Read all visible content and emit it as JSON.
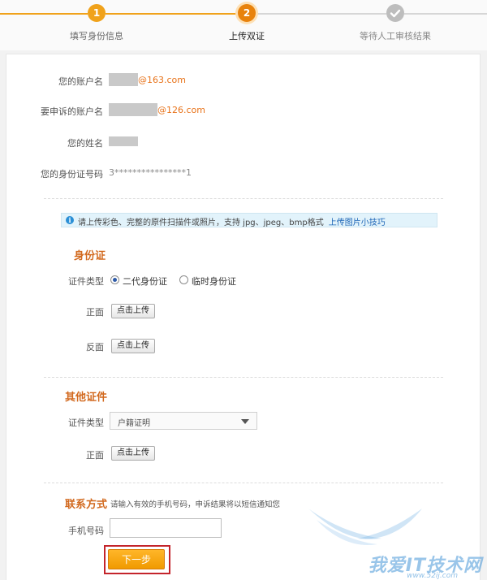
{
  "stepper": {
    "steps": [
      {
        "number": "1",
        "label": "填写身份信息"
      },
      {
        "number": "2",
        "label": "上传双证"
      },
      {
        "number": "",
        "label": "等待人工审核结果"
      }
    ],
    "colors": {
      "done": "#f0a21b",
      "active": "#e8820c",
      "pending": "#bdbdbd"
    }
  },
  "account": {
    "label": "您的账户名",
    "suffix": "@163.com"
  },
  "appeal_account": {
    "label": "要申诉的账户名",
    "suffix": "@126.com"
  },
  "name": {
    "label": "您的姓名"
  },
  "id_number": {
    "label": "您的身份证号码",
    "value": "3****************1"
  },
  "info_bar": {
    "text": "请上传彩色、完整的原件扫描件或照片，支持 jpg、jpeg、bmp格式",
    "link": "上传图片小技巧",
    "icon": "info-icon"
  },
  "id_card_section": {
    "title": "身份证",
    "type_label": "证件类型",
    "options": [
      "二代身份证",
      "临时身份证"
    ],
    "selected": "二代身份证",
    "front_label": "正面",
    "back_label": "反面",
    "upload_label": "点击上传"
  },
  "other_section": {
    "title": "其他证件",
    "type_label": "证件类型",
    "selected_type": "户籍证明",
    "front_label": "正面",
    "upload_label": "点击上传"
  },
  "contact_section": {
    "title": "联系方式",
    "hint": "请输入有效的手机号码，申诉结果将以短信通知您",
    "phone_label": "手机号码",
    "phone_value": ""
  },
  "next_button": "下一步",
  "watermark": {
    "text": "我爱IT技术网",
    "sub": "www.52ij.com"
  }
}
